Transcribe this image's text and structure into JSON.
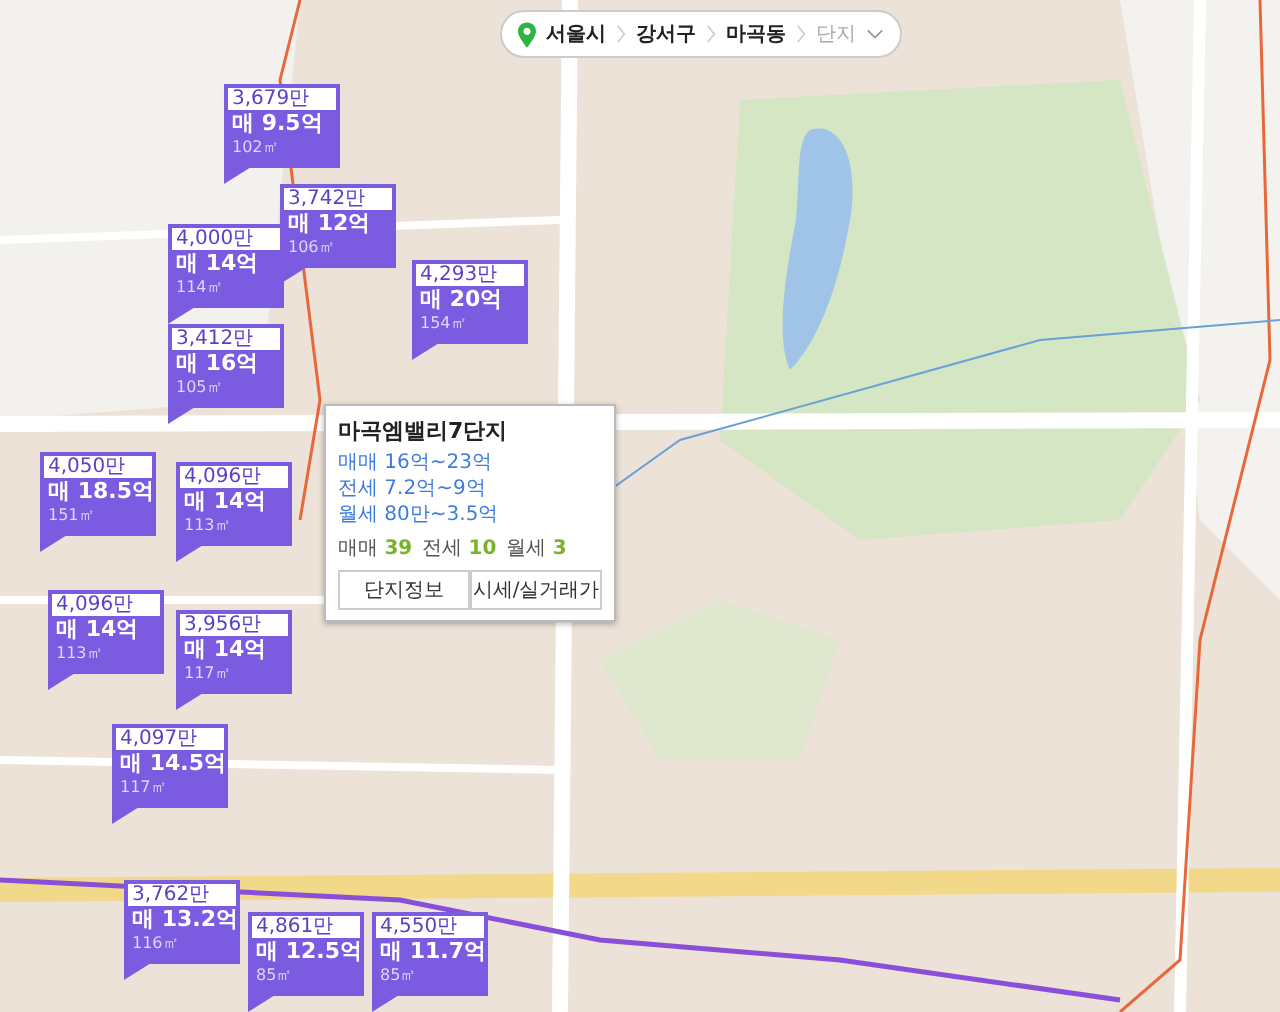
{
  "breadcrumb": [
    {
      "label": "서울시",
      "dimmed": false
    },
    {
      "label": "강서구",
      "dimmed": false
    },
    {
      "label": "마곡동",
      "dimmed": false
    },
    {
      "label": "단지",
      "dimmed": true
    }
  ],
  "markers": [
    {
      "unit_price": "3,679만",
      "price": "매 9.5억",
      "area": "102㎡"
    },
    {
      "unit_price": "3,742만",
      "price": "매 12억",
      "area": "106㎡"
    },
    {
      "unit_price": "4,000만",
      "price": "매 14억",
      "area": "114㎡"
    },
    {
      "unit_price": "3,412만",
      "price": "매 16억",
      "area": "105㎡"
    },
    {
      "unit_price": "4,293만",
      "price": "매 20억",
      "area": "154㎡"
    },
    {
      "unit_price": "4,050만",
      "price": "매 18.5억",
      "area": "151㎡"
    },
    {
      "unit_price": "4,096만",
      "price": "매 14억",
      "area": "113㎡"
    },
    {
      "unit_price": "4,096만",
      "price": "매 14억",
      "area": "113㎡"
    },
    {
      "unit_price": "3,956만",
      "price": "매 14억",
      "area": "117㎡"
    },
    {
      "unit_price": "4,097만",
      "price": "매 14.5억",
      "area": "117㎡"
    },
    {
      "unit_price": "3,762만",
      "price": "매 13.2억",
      "area": "116㎡"
    },
    {
      "unit_price": "4,861만",
      "price": "매 12.5억",
      "area": "85㎡"
    },
    {
      "unit_price": "4,550만",
      "price": "매 11.7억",
      "area": "85㎡"
    }
  ],
  "popup": {
    "title": "마곡엠밸리7단지",
    "ranges": [
      "매매 16억~23억",
      "전세 7.2억~9억",
      "월세 80만~3.5억"
    ],
    "counts": [
      {
        "label": "매매",
        "value": "39"
      },
      {
        "label": "전세",
        "value": "10"
      },
      {
        "label": "월세",
        "value": "3"
      }
    ],
    "buttons": [
      "단지정보",
      "시세/실거래가"
    ]
  }
}
